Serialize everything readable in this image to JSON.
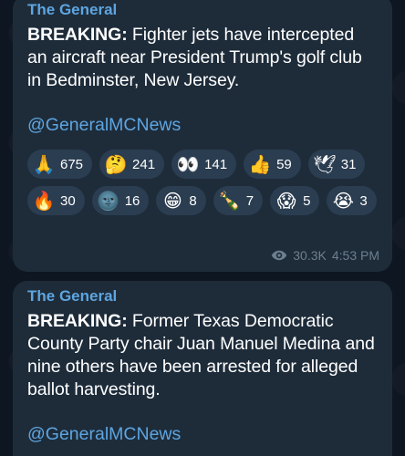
{
  "messages": [
    {
      "channel": "The General",
      "bold_prefix": "BREAKING:",
      "text": " Fighter jets have intercepted an aircraft near President Trump's golf club in Bedminster, New Jersey.",
      "link": "@GeneralMCNews",
      "reactions": [
        {
          "icon": "folded-hands",
          "glyph": "🙏",
          "count": "675"
        },
        {
          "icon": "thinking-face",
          "glyph": "🤔",
          "count": "241"
        },
        {
          "icon": "eyes",
          "glyph": "👀",
          "count": "141"
        },
        {
          "icon": "thumbs-up",
          "glyph": "👍",
          "count": "59"
        },
        {
          "icon": "dove",
          "glyph": "🕊",
          "count": "31"
        },
        {
          "icon": "fire",
          "glyph": "🔥",
          "count": "30"
        },
        {
          "icon": "new-moon-face",
          "glyph": "🌚",
          "count": "16"
        },
        {
          "icon": "grinning-face",
          "glyph": "😁",
          "count": "8"
        },
        {
          "icon": "champagne",
          "glyph": "🍾",
          "count": "7"
        },
        {
          "icon": "screaming-face",
          "glyph": "😱",
          "count": "5"
        },
        {
          "icon": "crying-face",
          "glyph": "😭",
          "count": "3"
        }
      ],
      "views": "30.3K",
      "time": "4:53 PM"
    },
    {
      "channel": "The General",
      "bold_prefix": "BREAKING:",
      "text": " Former Texas Democratic County Party chair Juan Manuel Medina and nine others have been arrested for alleged ballot harvesting.",
      "link": "@GeneralMCNews"
    }
  ],
  "colors": {
    "background": "#0e1621",
    "bubble": "#1e2c3a",
    "accent": "#5ea5e0",
    "reaction_bg": "#2b3d50",
    "meta": "#6d7f8f"
  }
}
